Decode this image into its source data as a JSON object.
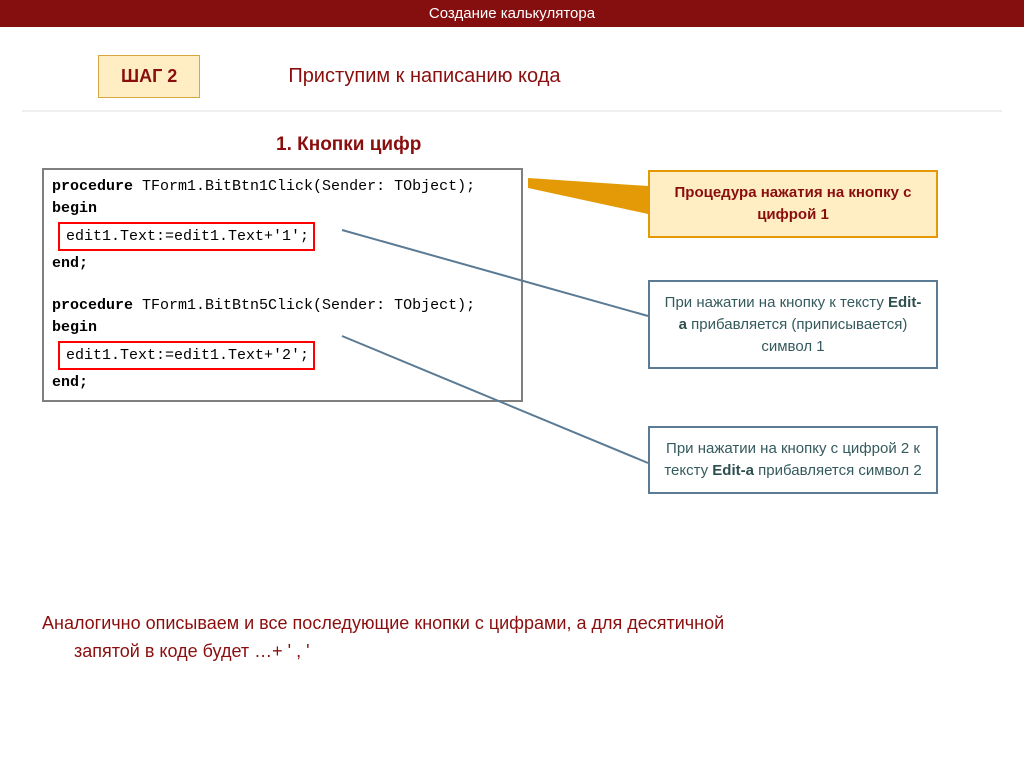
{
  "header": {
    "title": "Создание калькулятора"
  },
  "step": {
    "badge": "ШАГ 2",
    "title": "Приступим к написанию кода"
  },
  "section": {
    "heading": "1.  Кнопки цифр"
  },
  "code": {
    "proc1_decl": "procedure TForm1.BitBtn1Click(Sender: TObject);",
    "begin": "begin",
    "line1": "edit1.Text:=edit1.Text+'1';",
    "end": "end;",
    "proc2_decl": "procedure TForm1.BitBtn5Click(Sender: TObject);",
    "line2": "edit1.Text:=edit1.Text+'2';"
  },
  "callouts": {
    "c1": "Процедура нажатия на кнопку с цифрой 1",
    "c2_pre": "При нажатии на кнопку к тексту  ",
    "c2_em": "Edit-а",
    "c2_post": " прибавляется (приписывается) символ 1",
    "c3_pre": "При нажатии на кнопку с цифрой 2 к тексту ",
    "c3_em": "Edit-а",
    "c3_post": " прибавляется символ 2"
  },
  "bottom": {
    "line1": "Аналогично описываем и все последующие кнопки с цифрами, а для десятичной",
    "line2": "запятой в коде будет …+ ' , '"
  }
}
